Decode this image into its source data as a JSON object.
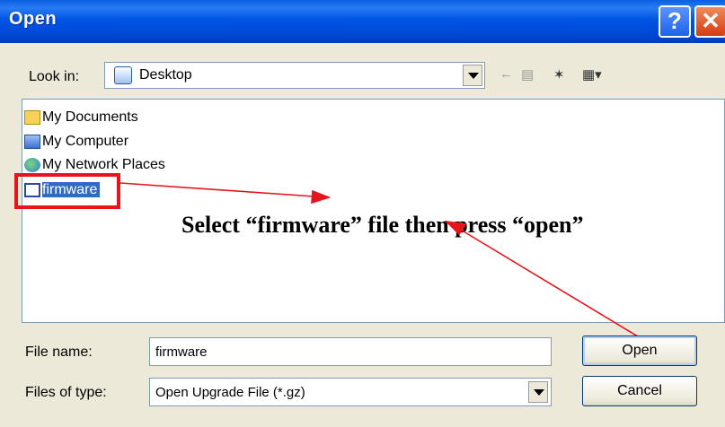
{
  "window": {
    "title": "Open"
  },
  "toolbar": {
    "look_in_label": "Look in:",
    "look_in_value": "Desktop"
  },
  "files": [
    {
      "label": "My Documents",
      "icon": "my-documents-icon"
    },
    {
      "label": "My Computer",
      "icon": "my-computer-icon"
    },
    {
      "label": "My Network Places",
      "icon": "network-places-icon"
    },
    {
      "label": "firmware",
      "icon": "firmware-file-icon",
      "selected": true
    }
  ],
  "annotation": {
    "text": "Select “firmware” file then press “open”"
  },
  "form": {
    "file_name_label": "File name:",
    "file_name_value": "firmware",
    "file_type_label": "Files of type:",
    "file_type_value": "Open Upgrade File (*.gz)",
    "open_button": "Open",
    "cancel_button": "Cancel"
  },
  "colors": {
    "title_bar": "#0055e5",
    "selection": "#316ac5",
    "highlight_box": "#e8141c",
    "arrow": "#e8141c"
  }
}
